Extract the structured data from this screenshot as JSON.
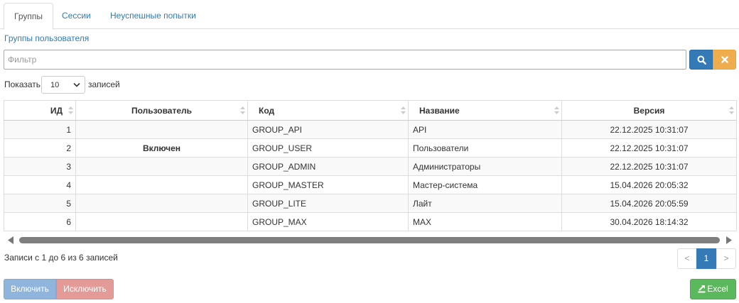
{
  "tabs": [
    {
      "label": "Группы",
      "active": true
    },
    {
      "label": "Сессии",
      "active": false
    },
    {
      "label": "Неуспешные попытки",
      "active": false
    }
  ],
  "section_title": "Группы пользователя",
  "filter": {
    "placeholder": "Фильтр",
    "value": ""
  },
  "icons": {
    "search": "search-icon",
    "clear": "close-icon",
    "excel": "export-icon"
  },
  "length": {
    "label_before": "Показать",
    "selected": "10",
    "label_after": "записей"
  },
  "table": {
    "columns": [
      "ИД",
      "Пользователь",
      "Код",
      "Название",
      "Версия"
    ],
    "rows": [
      {
        "id": "1",
        "user": "",
        "code": "GROUP_API",
        "name": "API",
        "version": "22.12.2025 10:31:07"
      },
      {
        "id": "2",
        "user": "Включен",
        "code": "GROUP_USER",
        "name": "Пользователи",
        "version": "22.12.2025 10:31:07"
      },
      {
        "id": "3",
        "user": "",
        "code": "GROUP_ADMIN",
        "name": "Администраторы",
        "version": "22.12.2025 10:31:07"
      },
      {
        "id": "4",
        "user": "",
        "code": "GROUP_MASTER",
        "name": "Мастер-система",
        "version": "15.04.2026 20:05:32"
      },
      {
        "id": "5",
        "user": "",
        "code": "GROUP_LITE",
        "name": "Лайт",
        "version": "15.04.2026 20:05:59"
      },
      {
        "id": "6",
        "user": "",
        "code": "GROUP_MAX",
        "name": "MAX",
        "version": "30.04.2026 18:14:32"
      }
    ]
  },
  "info": "Записи с 1 до 6 из 6 записей",
  "pagination": {
    "prev": "<",
    "current": "1",
    "next": ">"
  },
  "buttons": {
    "enable": "Включить",
    "disable": "Исключить",
    "excel": "Excel"
  },
  "colors": {
    "primary": "#337ab7",
    "warning": "#f0ad4e",
    "success": "#5cb85c",
    "danger_disabled": "#e49b98",
    "primary_disabled": "#8fb5dc"
  }
}
